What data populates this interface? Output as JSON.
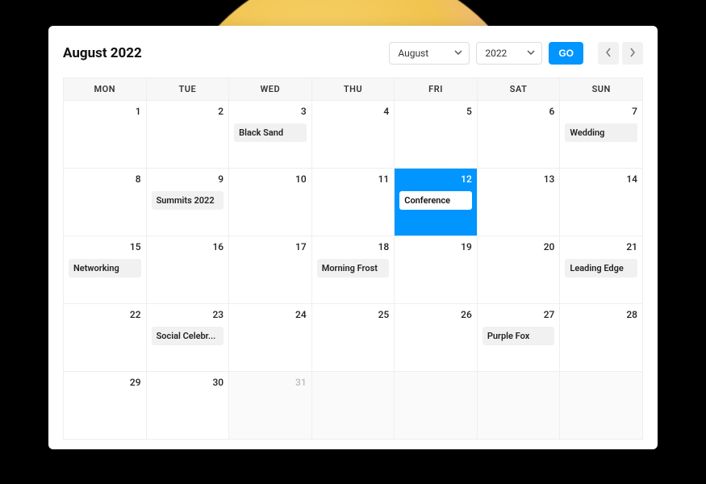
{
  "header": {
    "title": "August 2022",
    "month_select": "August",
    "year_select": "2022",
    "go_label": "GO"
  },
  "weekdays": [
    "MON",
    "TUE",
    "WED",
    "THU",
    "FRI",
    "SAT",
    "SUN"
  ],
  "weeks": [
    [
      {
        "n": "1"
      },
      {
        "n": "2"
      },
      {
        "n": "3",
        "ev": "Black Sand"
      },
      {
        "n": "4"
      },
      {
        "n": "5"
      },
      {
        "n": "6"
      },
      {
        "n": "7",
        "ev": "Wedding"
      }
    ],
    [
      {
        "n": "8"
      },
      {
        "n": "9",
        "ev": "Summits 2022"
      },
      {
        "n": "10"
      },
      {
        "n": "11"
      },
      {
        "n": "12",
        "ev": "Conference",
        "hl": true
      },
      {
        "n": "13"
      },
      {
        "n": "14"
      }
    ],
    [
      {
        "n": "15",
        "ev": "Networking"
      },
      {
        "n": "16"
      },
      {
        "n": "17"
      },
      {
        "n": "18",
        "ev": "Morning Frost"
      },
      {
        "n": "19"
      },
      {
        "n": "20"
      },
      {
        "n": "21",
        "ev": "Leading Edge"
      }
    ],
    [
      {
        "n": "22"
      },
      {
        "n": "23",
        "ev": "Social Celebr..."
      },
      {
        "n": "24"
      },
      {
        "n": "25"
      },
      {
        "n": "26"
      },
      {
        "n": "27",
        "ev": "Purple Fox"
      },
      {
        "n": "28"
      }
    ],
    [
      {
        "n": "29"
      },
      {
        "n": "30"
      },
      {
        "n": "31",
        "muted": true
      },
      {
        "empty": true
      },
      {
        "empty": true
      },
      {
        "empty": true
      },
      {
        "empty": true
      }
    ]
  ]
}
